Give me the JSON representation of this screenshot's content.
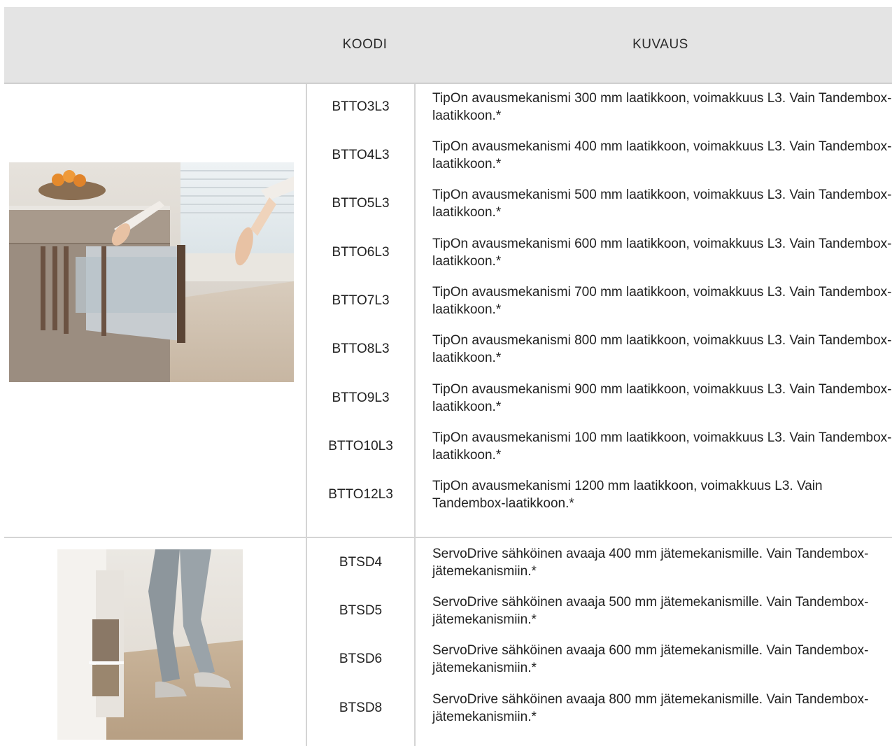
{
  "header": {
    "code_label": "KOODI",
    "description_label": "KUVAUS"
  },
  "groups": [
    {
      "image": "kitchen-drawer-tipon-photo",
      "rows": [
        {
          "code": "BTTO3L3",
          "description": "TipOn avausmekanismi 300 mm laatikkoon, voimakkuus L3. Vain Tandembox-laatikkoon.*"
        },
        {
          "code": "BTTO4L3",
          "description": "TipOn avausmekanismi 400 mm laatikkoon, voimakkuus L3. Vain Tandembox-laatikkoon.*"
        },
        {
          "code": "BTTO5L3",
          "description": "TipOn avausmekanismi 500 mm laatikkoon, voimakkuus L3. Vain Tandembox-laatikkoon.*"
        },
        {
          "code": "BTTO6L3",
          "description": "TipOn avausmekanismi 600 mm laatikkoon, voimakkuus L3. Vain Tandembox-laatikkoon.*"
        },
        {
          "code": "BTTO7L3",
          "description": "TipOn avausmekanismi 700 mm laatikkoon, voimakkuus L3. Vain Tandembox-laatikkoon.*"
        },
        {
          "code": "BTTO8L3",
          "description": "TipOn avausmekanismi 800 mm laatikkoon, voimakkuus L3. Vain Tandembox-laatikkoon.*"
        },
        {
          "code": "BTTO9L3",
          "description": "TipOn avausmekanismi 900 mm laatikkoon, voimakkuus L3. Vain Tandembox-laatikkoon.*"
        },
        {
          "code": "BTTO10L3",
          "description": "TipOn avausmekanismi 100 mm laatikkoon, voimakkuus L3. Vain Tandembox-laatikkoon.*"
        },
        {
          "code": "BTTO12L3",
          "description": "TipOn avausmekanismi 1200 mm laatikkoon, voimakkuus L3. Vain Tandembox-laatikkoon.*"
        }
      ]
    },
    {
      "image": "servodrive-foot-open-photo",
      "rows": [
        {
          "code": "BTSD4",
          "description": "ServoDrive sähköinen avaaja 400 mm jätemekanismille. Vain Tandembox-jätemekanismiin.*"
        },
        {
          "code": "BTSD5",
          "description": "ServoDrive sähköinen avaaja 500 mm jätemekanismille. Vain Tandembox-jätemekanismiin.*"
        },
        {
          "code": "BTSD6",
          "description": "ServoDrive sähköinen avaaja 600 mm jätemekanismille. Vain Tandembox-jätemekanismiin.*"
        },
        {
          "code": "BTSD8",
          "description": "ServoDrive sähköinen avaaja 800 mm jätemekanismille. Vain Tandembox-jätemekanismiin.*"
        }
      ]
    }
  ]
}
